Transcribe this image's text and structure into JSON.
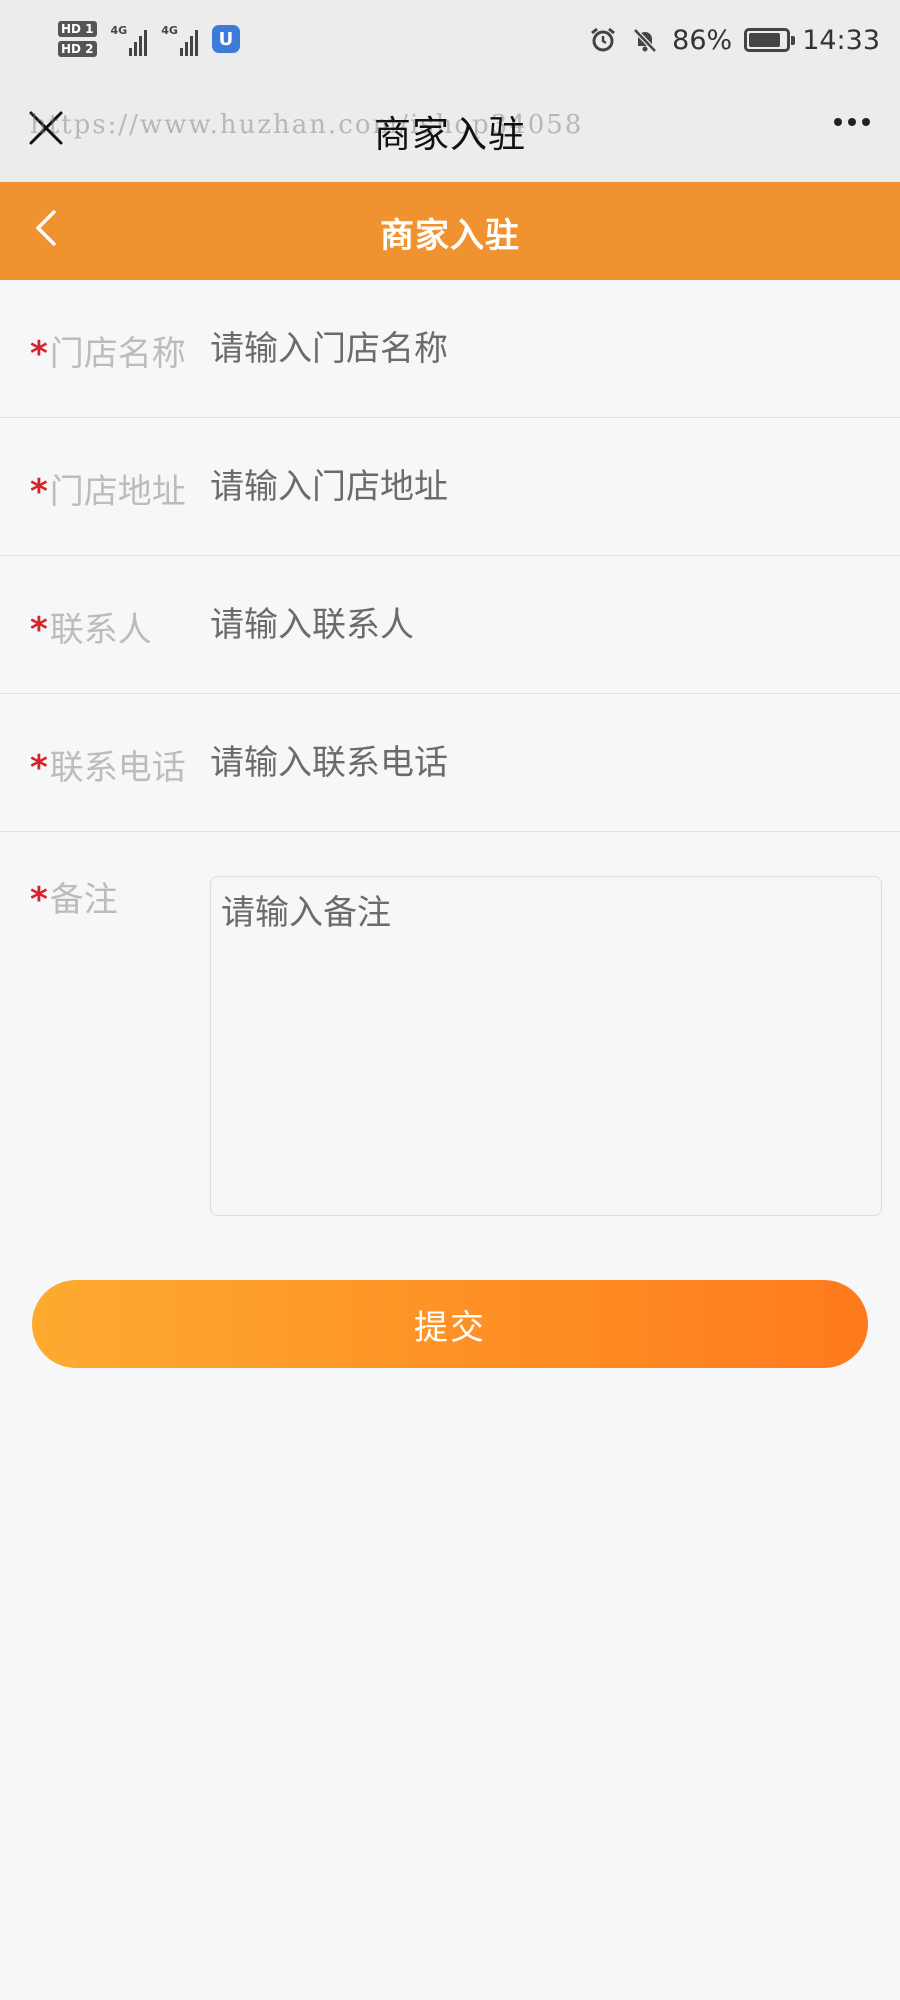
{
  "status_bar": {
    "sim1_label": "HD 1",
    "sim2_label": "HD 2",
    "network1": "4G",
    "network2": "4G",
    "app_badge": "U",
    "battery_percent": "86%",
    "battery_level": 0.86,
    "time": "14:33"
  },
  "web_bar": {
    "title": "商家入驻",
    "watermark": "https://www.huzhan.com/ishop34058"
  },
  "header": {
    "title": "商家入驻"
  },
  "form": {
    "required_mark": "*",
    "fields": [
      {
        "label": "门店名称",
        "placeholder": "请输入门店名称"
      },
      {
        "label": "门店地址",
        "placeholder": "请输入门店地址"
      },
      {
        "label": "联系人",
        "placeholder": "请输入联系人"
      },
      {
        "label": "联系电话",
        "placeholder": "请输入联系电话"
      }
    ],
    "note": {
      "label": "备注",
      "placeholder": "请输入备注"
    },
    "submit_label": "提交"
  },
  "colors": {
    "header": "#f0922f",
    "submit_start": "#fdaa2f",
    "submit_end": "#fe7a1d",
    "required": "#d3242b"
  }
}
